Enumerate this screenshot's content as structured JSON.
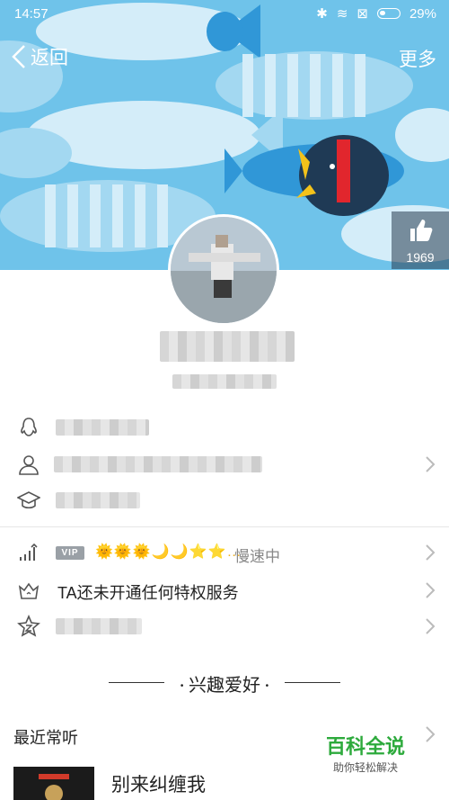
{
  "status_bar": {
    "time": "14:57",
    "battery": "29%"
  },
  "header": {
    "back_label": "返回",
    "more_label": "更多"
  },
  "like": {
    "count": "1969"
  },
  "vip": {
    "badge": "VIP",
    "level_icons": "🌞🌞🌞🌙🌙⭐⭐…",
    "speed": "慢速中"
  },
  "privilege": {
    "text": "TA还未开通任何特权服务"
  },
  "section": {
    "title": "兴趣爱好"
  },
  "recent": {
    "label": "最近常听",
    "song": "别来纠缠我"
  },
  "watermark": {
    "brand": "百科全说",
    "tagline": "助你轻松解决"
  },
  "colors": {
    "sky": "#6fc3ea",
    "fish_light": "#dff2fb",
    "fish_blue": "#2a93d6",
    "text": "#222222",
    "level_gold": "#f2b321"
  }
}
